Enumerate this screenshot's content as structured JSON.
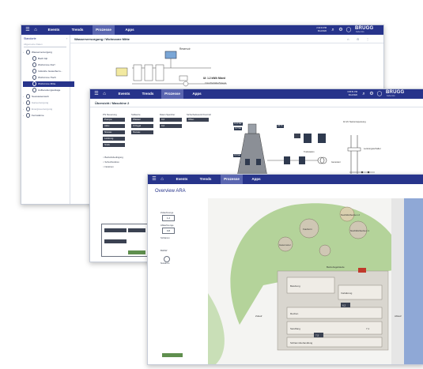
{
  "brand": {
    "name": "BRUGG",
    "sub": "Kabel AG"
  },
  "nav": {
    "events": "Events",
    "trends": "Trends",
    "prozesse": "Prozesse",
    "apps": "Apps"
  },
  "window1": {
    "breadcrumb": "Wasserversorgung  /  Wohnzone Mitte",
    "clock": [
      "2:42:04 PM",
      "8/12/2020"
    ],
    "sidebar": {
      "title": "Standorte",
      "search_placeholder": "Allgemeine Daten",
      "items": [
        {
          "label": "Wasserversorgung",
          "level": 0
        },
        {
          "label": "Bach Alp",
          "level": 1
        },
        {
          "label": "Wohnzone Dorf",
          "level": 1
        },
        {
          "label": "Industrie Gewerbezo...",
          "level": 1
        },
        {
          "label": "Wohnzone Hoch",
          "level": 1
        },
        {
          "label": "Wohnzone Mitte",
          "level": 1
        },
        {
          "label": "Aufbereitungsanlage",
          "level": 1
        },
        {
          "label": "Seewasserwerk",
          "level": 0
        },
        {
          "label": "Gasversorgung",
          "level": 0
        },
        {
          "label": "Energieversorgung",
          "level": 0
        },
        {
          "label": "Fernwärme",
          "level": 0
        }
      ],
      "active_index": 5
    },
    "diagram": {
      "reservoir": "Reservoir",
      "pump_label": "UI: 1.2 kW/h Mixed",
      "pump_sub": "3 Hochbehälter/Spiegel"
    }
  },
  "window2": {
    "breadcrumb": "Übersicht  /  Maschine 2",
    "clock": [
      "3:45:51 PM",
      "8/12/2020"
    ],
    "groups": [
      {
        "title": "Phi Steuerung",
        "values": [
          "Pumpe",
          "Aktiv",
          "Niveau",
          "Leistung",
          "Stufe"
        ]
      },
      {
        "title": "Sollwerte",
        "values": [
          "Wasser",
          "0 Pegel",
          "Niveau"
        ]
      },
      {
        "title": "Daten Speicher",
        "values": [
          "0,0",
          "0,0"
        ]
      },
      {
        "title": "Sicherheitsventil Kontroll",
        "values": [
          "Offen"
        ]
      }
    ],
    "readings": [
      "14,2 bar",
      "3,2 bar",
      "0,0 bar",
      "24 °C"
    ],
    "options": [
      "Betriebsbedingung",
      "Schutzfunktion",
      "Notstrom"
    ],
    "valves": [
      "Drosselklappe",
      "Schieber 1",
      "Schieber 2",
      "Stromrichter"
    ],
    "right_labels": [
      "10 kV Netzeinspeisung",
      "Leistungsschalter",
      "Trafostation",
      "Generator"
    ]
  },
  "window3": {
    "title": "Overview ARA",
    "left_panel": [
      "Zulaufmenge",
      "Ablaufmenge",
      "Schlamm",
      "BHKW",
      "Notstrom"
    ],
    "left_values": [
      "1,2",
      "0,8"
    ],
    "map_labels": [
      "Faulturm",
      "Nachklärbecken 1",
      "Nachklärbecken 2",
      "Gasometer",
      "Belebung",
      "Vorklärung",
      "Rechen",
      "Sandfang",
      "Schlammbehandlung",
      "Betriebsgebäude",
      "Zulauf",
      "Ablauf"
    ],
    "map_values": [
      "7,5",
      "6,2",
      "7,1"
    ]
  },
  "colors": {
    "nav_bg": "#27348b",
    "nav_active": "#5a66b0",
    "field_bg": "#3b4252",
    "grass": "#b4d39a",
    "water": "#8fa8d6"
  }
}
